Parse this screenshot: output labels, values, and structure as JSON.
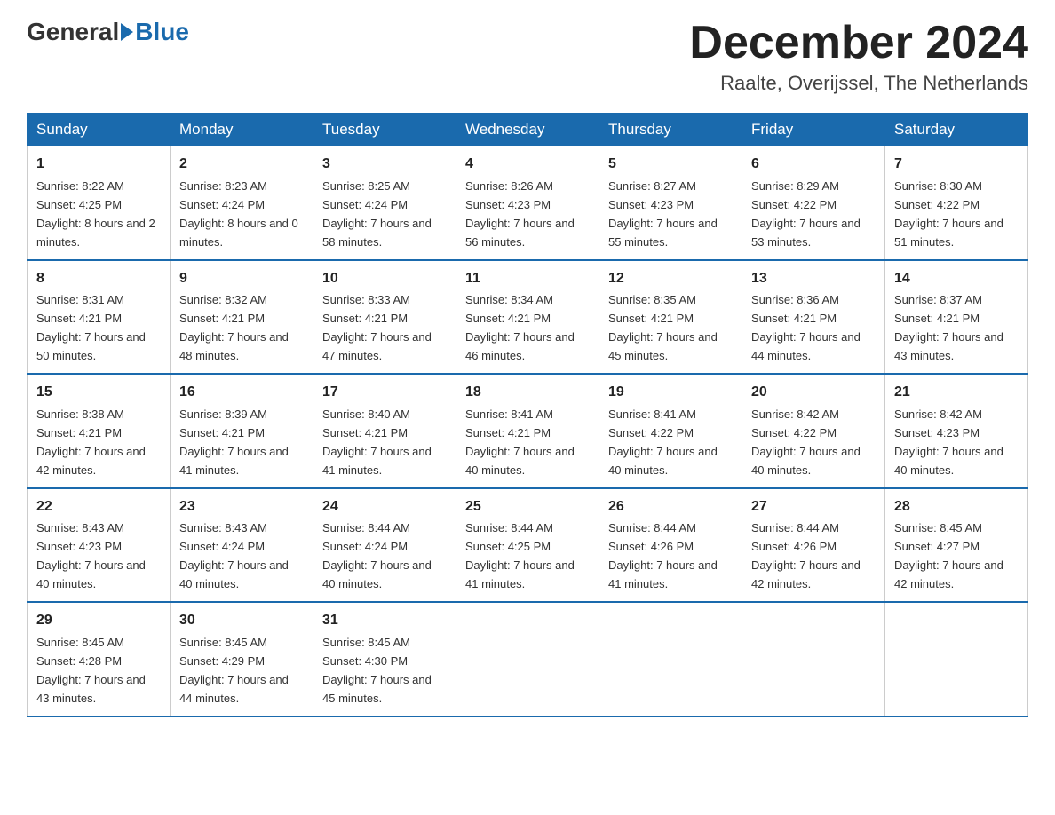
{
  "logo": {
    "general": "General",
    "blue": "Blue"
  },
  "title": "December 2024",
  "subtitle": "Raalte, Overijssel, The Netherlands",
  "days": [
    "Sunday",
    "Monday",
    "Tuesday",
    "Wednesday",
    "Thursday",
    "Friday",
    "Saturday"
  ],
  "weeks": [
    [
      {
        "day": "1",
        "sunrise": "8:22 AM",
        "sunset": "4:25 PM",
        "daylight": "8 hours and 2 minutes."
      },
      {
        "day": "2",
        "sunrise": "8:23 AM",
        "sunset": "4:24 PM",
        "daylight": "8 hours and 0 minutes."
      },
      {
        "day": "3",
        "sunrise": "8:25 AM",
        "sunset": "4:24 PM",
        "daylight": "7 hours and 58 minutes."
      },
      {
        "day": "4",
        "sunrise": "8:26 AM",
        "sunset": "4:23 PM",
        "daylight": "7 hours and 56 minutes."
      },
      {
        "day": "5",
        "sunrise": "8:27 AM",
        "sunset": "4:23 PM",
        "daylight": "7 hours and 55 minutes."
      },
      {
        "day": "6",
        "sunrise": "8:29 AM",
        "sunset": "4:22 PM",
        "daylight": "7 hours and 53 minutes."
      },
      {
        "day": "7",
        "sunrise": "8:30 AM",
        "sunset": "4:22 PM",
        "daylight": "7 hours and 51 minutes."
      }
    ],
    [
      {
        "day": "8",
        "sunrise": "8:31 AM",
        "sunset": "4:21 PM",
        "daylight": "7 hours and 50 minutes."
      },
      {
        "day": "9",
        "sunrise": "8:32 AM",
        "sunset": "4:21 PM",
        "daylight": "7 hours and 48 minutes."
      },
      {
        "day": "10",
        "sunrise": "8:33 AM",
        "sunset": "4:21 PM",
        "daylight": "7 hours and 47 minutes."
      },
      {
        "day": "11",
        "sunrise": "8:34 AM",
        "sunset": "4:21 PM",
        "daylight": "7 hours and 46 minutes."
      },
      {
        "day": "12",
        "sunrise": "8:35 AM",
        "sunset": "4:21 PM",
        "daylight": "7 hours and 45 minutes."
      },
      {
        "day": "13",
        "sunrise": "8:36 AM",
        "sunset": "4:21 PM",
        "daylight": "7 hours and 44 minutes."
      },
      {
        "day": "14",
        "sunrise": "8:37 AM",
        "sunset": "4:21 PM",
        "daylight": "7 hours and 43 minutes."
      }
    ],
    [
      {
        "day": "15",
        "sunrise": "8:38 AM",
        "sunset": "4:21 PM",
        "daylight": "7 hours and 42 minutes."
      },
      {
        "day": "16",
        "sunrise": "8:39 AM",
        "sunset": "4:21 PM",
        "daylight": "7 hours and 41 minutes."
      },
      {
        "day": "17",
        "sunrise": "8:40 AM",
        "sunset": "4:21 PM",
        "daylight": "7 hours and 41 minutes."
      },
      {
        "day": "18",
        "sunrise": "8:41 AM",
        "sunset": "4:21 PM",
        "daylight": "7 hours and 40 minutes."
      },
      {
        "day": "19",
        "sunrise": "8:41 AM",
        "sunset": "4:22 PM",
        "daylight": "7 hours and 40 minutes."
      },
      {
        "day": "20",
        "sunrise": "8:42 AM",
        "sunset": "4:22 PM",
        "daylight": "7 hours and 40 minutes."
      },
      {
        "day": "21",
        "sunrise": "8:42 AM",
        "sunset": "4:23 PM",
        "daylight": "7 hours and 40 minutes."
      }
    ],
    [
      {
        "day": "22",
        "sunrise": "8:43 AM",
        "sunset": "4:23 PM",
        "daylight": "7 hours and 40 minutes."
      },
      {
        "day": "23",
        "sunrise": "8:43 AM",
        "sunset": "4:24 PM",
        "daylight": "7 hours and 40 minutes."
      },
      {
        "day": "24",
        "sunrise": "8:44 AM",
        "sunset": "4:24 PM",
        "daylight": "7 hours and 40 minutes."
      },
      {
        "day": "25",
        "sunrise": "8:44 AM",
        "sunset": "4:25 PM",
        "daylight": "7 hours and 41 minutes."
      },
      {
        "day": "26",
        "sunrise": "8:44 AM",
        "sunset": "4:26 PM",
        "daylight": "7 hours and 41 minutes."
      },
      {
        "day": "27",
        "sunrise": "8:44 AM",
        "sunset": "4:26 PM",
        "daylight": "7 hours and 42 minutes."
      },
      {
        "day": "28",
        "sunrise": "8:45 AM",
        "sunset": "4:27 PM",
        "daylight": "7 hours and 42 minutes."
      }
    ],
    [
      {
        "day": "29",
        "sunrise": "8:45 AM",
        "sunset": "4:28 PM",
        "daylight": "7 hours and 43 minutes."
      },
      {
        "day": "30",
        "sunrise": "8:45 AM",
        "sunset": "4:29 PM",
        "daylight": "7 hours and 44 minutes."
      },
      {
        "day": "31",
        "sunrise": "8:45 AM",
        "sunset": "4:30 PM",
        "daylight": "7 hours and 45 minutes."
      },
      null,
      null,
      null,
      null
    ]
  ],
  "labels": {
    "sunrise": "Sunrise:",
    "sunset": "Sunset:",
    "daylight": "Daylight:"
  }
}
